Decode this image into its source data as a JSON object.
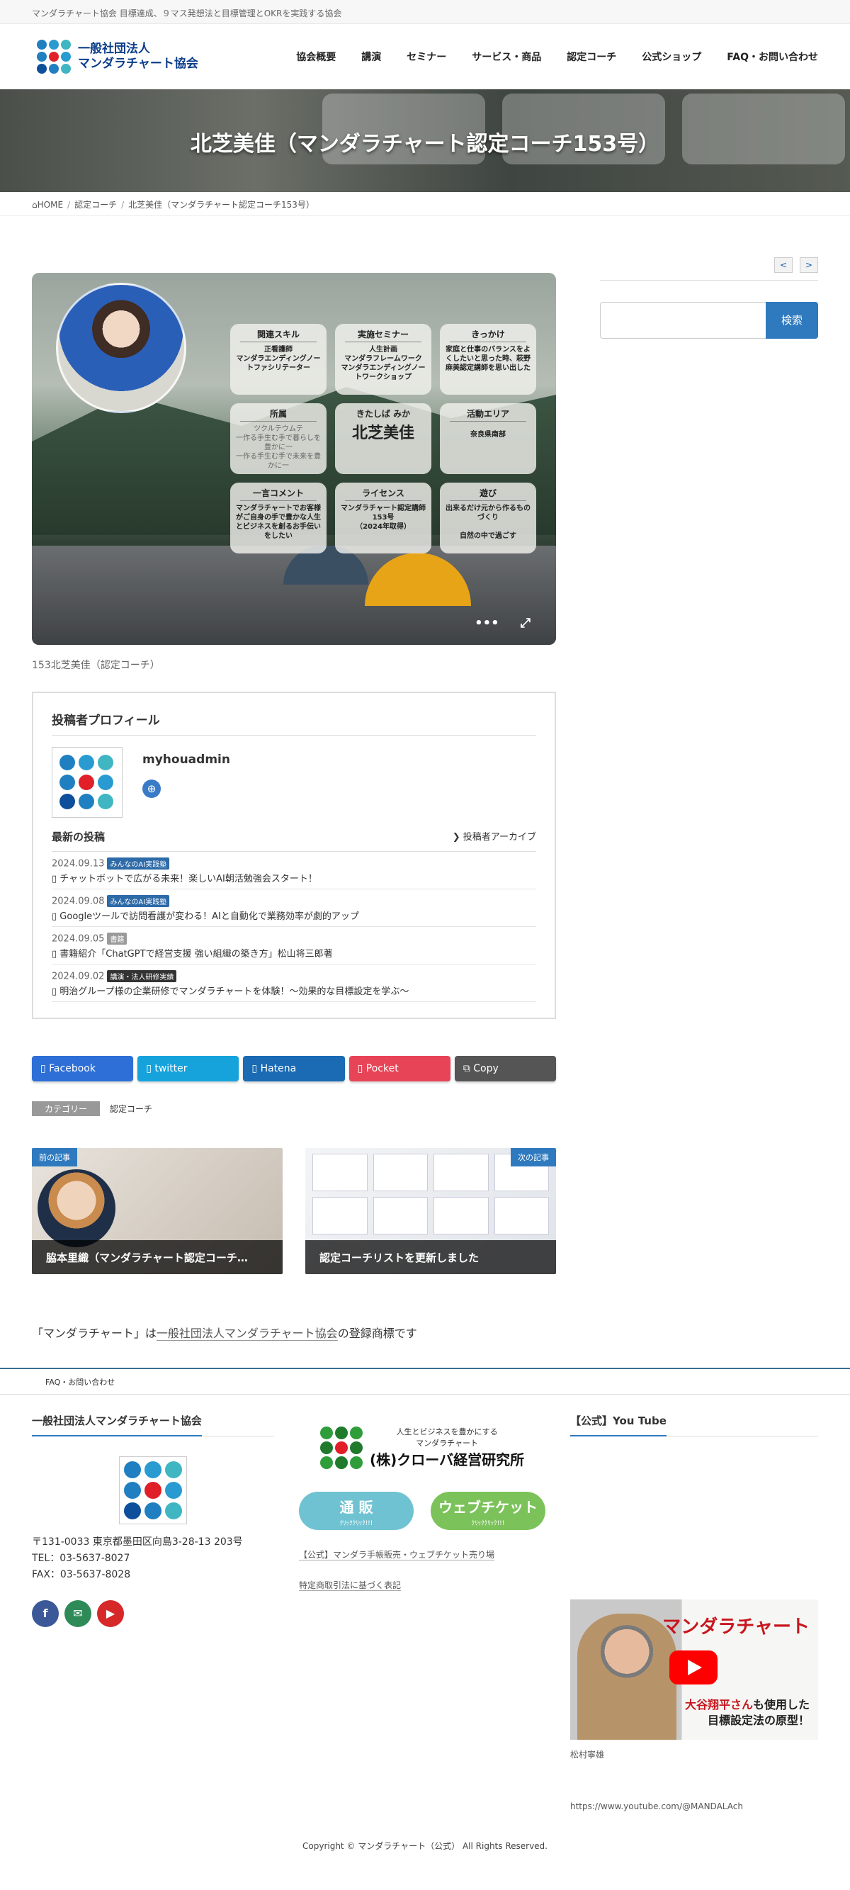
{
  "topbar": {
    "text": "マンダラチャート協会 目標達成、９マス発想法と目標管理とOKRを実践する協会"
  },
  "header": {
    "logo_line1": "一般社団法人",
    "logo_line2": "マンダラチャート協会",
    "nav": [
      "協会概要",
      "講演",
      "セミナー",
      "サービス・商品",
      "認定コーチ",
      "公式ショップ",
      "FAQ・お問い合わせ"
    ]
  },
  "hero": {
    "title": "北芝美佳（マンダラチャート認定コーチ153号）"
  },
  "breadcrumb": {
    "home": "HOME",
    "parent": "認定コーチ",
    "current": "北芝美佳（マンダラチャート認定コーチ153号）"
  },
  "pager": {
    "prev": "<",
    "next": ">"
  },
  "search": {
    "button": "検索",
    "placeholder": ""
  },
  "eyecatch": {
    "cards": [
      {
        "head": "関連スキル",
        "body": "正看護師\nマンダラエンディングノートファシリテーター"
      },
      {
        "head": "実施セミナー",
        "body": "人生計画\nマンダラフレームワーク\nマンダラエンディングノートワークショップ"
      },
      {
        "head": "きっかけ",
        "body": "家庭と仕事のバランスをよくしたいと思った時、萩野麻美認定講師を思い出した"
      },
      {
        "head": "所属",
        "body": "ツクルテウムテ\n一作る手生む手で暮らしを豊かに一\n一作る手生む手で未来を豊かに一"
      },
      {
        "head": "きたしば みか",
        "body": "北芝美佳"
      },
      {
        "head": "活動エリア",
        "body": "奈良県南部"
      },
      {
        "head": "一言コメント",
        "body": "マンダラチャートでお客様がご自身の手で豊かな人生とビジネスを創るお手伝いをしたい"
      },
      {
        "head": "ライセンス",
        "body": "マンダラチャート認定講師153号\n（2024年取得）"
      },
      {
        "head": "遊び",
        "body": "出来るだけ元から作るものづくり\n\n自然の中で過ごす"
      }
    ],
    "more_icon": "•••",
    "expand_icon": "⤢",
    "caption": "153北芝美佳（認定コーチ）"
  },
  "profile": {
    "title": "投稿者プロフィール",
    "author": "myhouadmin",
    "recent_title": "最新の投稿",
    "archive_link": "投稿者アーカイブ",
    "posts": [
      {
        "date": "2024.09.13",
        "tag": "みんなのAI実践塾",
        "tag_color": "#2d6aa8",
        "title": "チャットボットで広がる未来！楽しいAI朝活勉強会スタート！"
      },
      {
        "date": "2024.09.08",
        "tag": "みんなのAI実践塾",
        "tag_color": "#2d6aa8",
        "title": "Googleツールで訪問看護が変わる！AIと自動化で業務効率が劇的アップ"
      },
      {
        "date": "2024.09.05",
        "tag": "書籍",
        "tag_color": "#9a9a9a",
        "title": "書籍紹介「ChatGPTで経営支援 強い組織の築き方」松山将三郎著"
      },
      {
        "date": "2024.09.02",
        "tag": "講演・法人研修実績",
        "tag_color": "#333333",
        "title": "明治グループ様の企業研修でマンダラチャートを体験！〜効果的な目標設定を学ぶ〜"
      }
    ]
  },
  "share": [
    {
      "label": "Facebook",
      "color": "#2d6fd6"
    },
    {
      "label": "twitter",
      "color": "#16a3dc"
    },
    {
      "label": "Hatena",
      "color": "#1a6ab4"
    },
    {
      "label": "Pocket",
      "color": "#e84457"
    },
    {
      "label": "Copy",
      "color": "#555555"
    }
  ],
  "category": {
    "label": "カテゴリー",
    "value": "認定コーチ"
  },
  "nextprev": {
    "prev_badge": "前の記事",
    "prev_title": "脇本里織（マンダラチャート認定コーチ…",
    "next_badge": "次の記事",
    "next_title": "認定コーチリストを更新しました"
  },
  "trademark": {
    "pre": "「マンダラチャート」は",
    "link": "一般社団法人マンダラチャート協会",
    "post": "の登録商標です"
  },
  "footnav": {
    "link": "FAQ・お問い合わせ"
  },
  "footer": {
    "col1_title": "一般社団法人マンダラチャート協会",
    "address": "〒131-0033 東京都墨田区向島3-28-13 203号",
    "tel": "TEL：03-5637-8027",
    "fax": "FAX：03-5637-8028",
    "clover_small": "人生とビジネスを豊かにする\nマンダラチャート",
    "clover_big": "(株)クローバ経営研究所",
    "pill1_main": "通 販",
    "pill1_sub": "ｸﾘｯｸｸﾘｯｸ!!!",
    "pill2_main": "ウェブチケット",
    "pill2_sub": "ｸﾘｯｸｸﾘｯｸ!!!",
    "link1": "【公式】マンダラ手帳販売・ウェブチケット売り場",
    "link2": "特定商取引法に基づく表記",
    "col3_title": "【公式】You Tube",
    "yt_title": "マンダラチャート",
    "yt_sub_em": "大谷翔平さん",
    "yt_sub_rest": "も使用した",
    "yt_sub2": "目標設定法の原型！",
    "yt_name": "松村寧雄",
    "yt_url": "https://www.youtube.com/@MANDALAch"
  },
  "copyright": "Copyright © マンダラチャート（公式） All Rights Reserved.",
  "colors": {
    "grid": [
      "#1f7fc0",
      "#2a9bd1",
      "#3fb6c2",
      "#1f7fc0",
      "#e01f28",
      "#2a9bd1",
      "#0d4f9b",
      "#1f7fc0",
      "#3fb6c2"
    ],
    "clover": [
      "#2e9d3a",
      "#1f7a2c",
      "#2e9d3a",
      "#1f7a2c",
      "#e01f28",
      "#1f7a2c",
      "#2e9d3a",
      "#1f7a2c",
      "#2e9d3a"
    ]
  }
}
